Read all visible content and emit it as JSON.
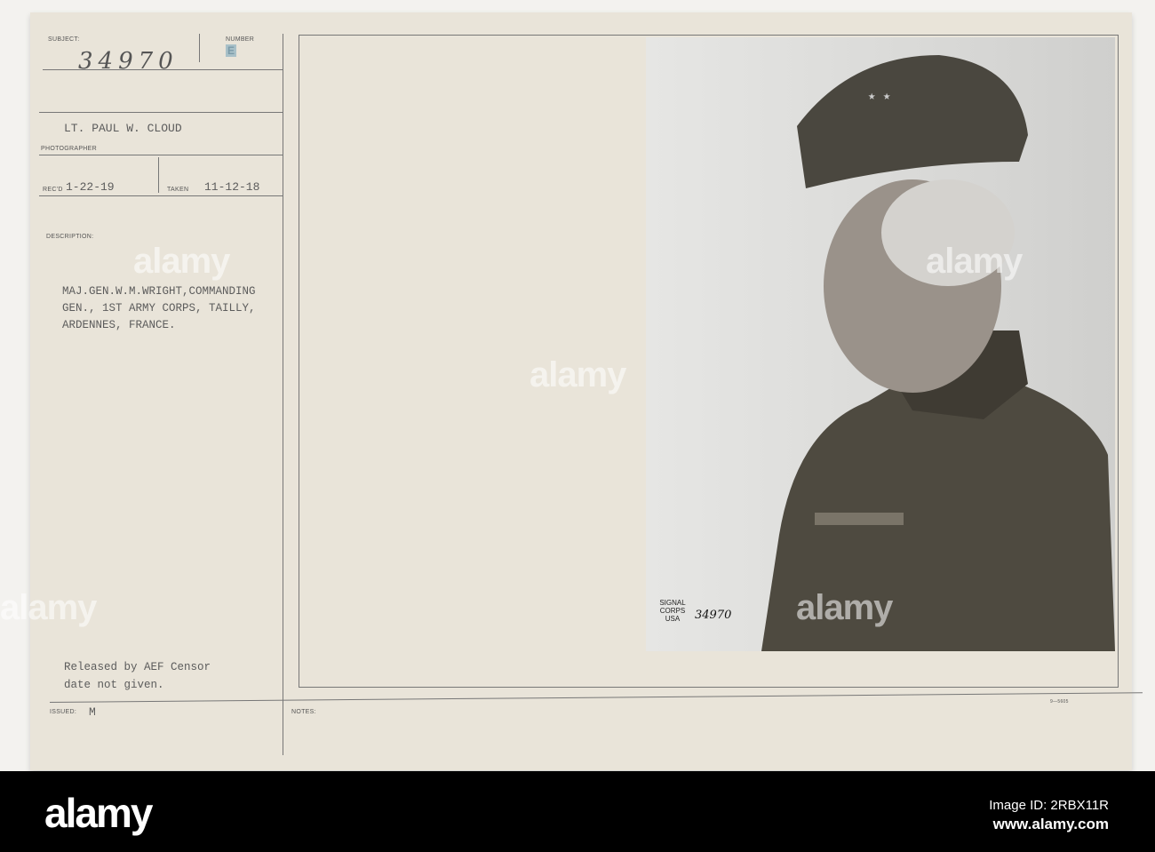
{
  "card": {
    "subject_label": "SUBJECT:",
    "subject_value": "34970",
    "number_label": "NUMBER",
    "number_value": "E",
    "photographer_value": "LT. PAUL W. CLOUD",
    "photographer_label": "PHOTOGRAPHER",
    "recd_label": "REC'D",
    "recd_value": "1-22-19",
    "taken_label": "TAKEN",
    "taken_value": "11-12-18",
    "description_label": "DESCRIPTION:",
    "description_lines": [
      "MAJ.GEN.W.M.WRIGHT,COMMANDING",
      "GEN., 1ST ARMY CORPS, TAILLY,",
      "ARDENNES, FRANCE."
    ],
    "release_lines": [
      "Released by AEF Censor",
      "date not given."
    ],
    "issued_label": "ISSUED:",
    "issued_value": "M",
    "notes_label": "NOTES:",
    "form_number": "9—5605"
  },
  "photo": {
    "stamp_text": "SIGNAL CORPS USA",
    "stamp_number": "34970"
  },
  "watermark": "alamy",
  "footer": {
    "logo": "alamy",
    "image_id": "Image ID: 2RBX11R",
    "url": "www.alamy.com"
  }
}
